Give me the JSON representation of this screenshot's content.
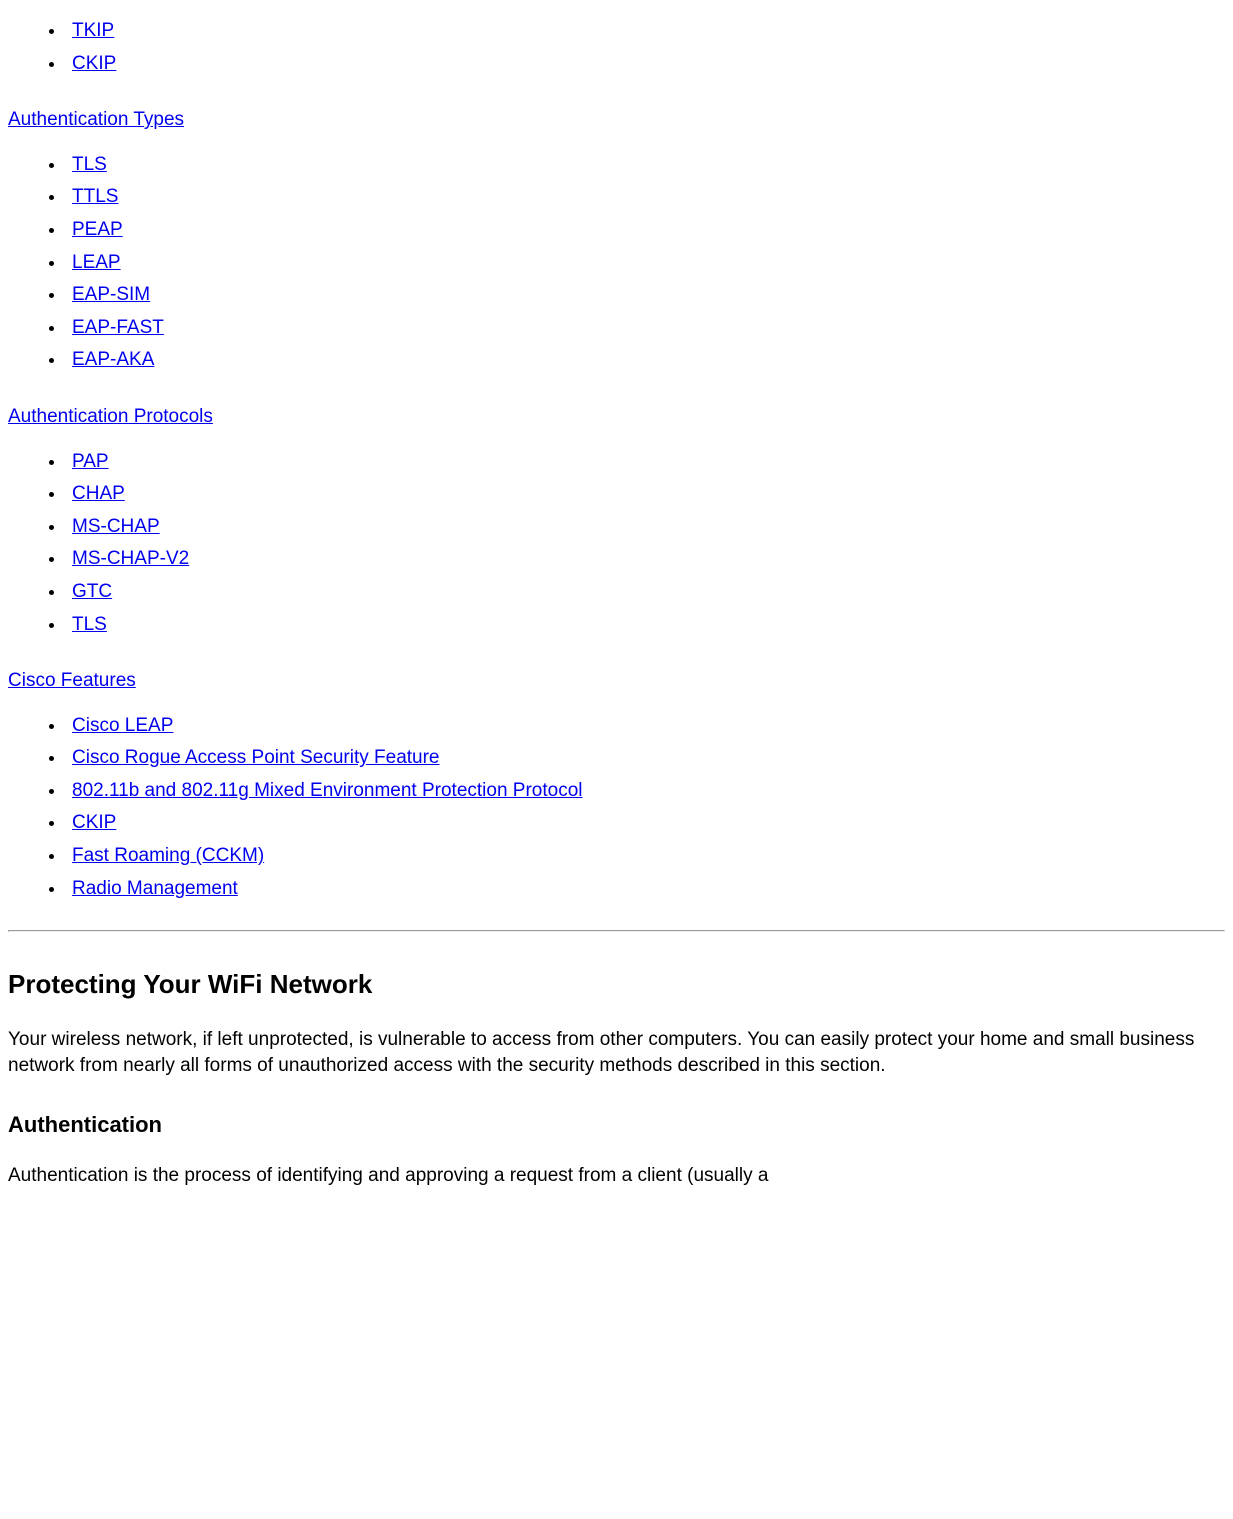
{
  "top_items": [
    "TKIP",
    "CKIP"
  ],
  "sections": [
    {
      "title": "Authentication Types",
      "items": [
        "TLS",
        "TTLS",
        "PEAP",
        "LEAP",
        "EAP-SIM",
        "EAP-FAST",
        "EAP-AKA"
      ]
    },
    {
      "title": "Authentication Protocols",
      "items": [
        "PAP",
        "CHAP",
        "MS-CHAP",
        "MS-CHAP-V2",
        "GTC",
        "TLS"
      ]
    },
    {
      "title": "Cisco Features",
      "items": [
        "Cisco LEAP",
        "Cisco Rogue Access Point Security Feature",
        "802.11b and 802.11g Mixed Environment Protection Protocol",
        "CKIP",
        "Fast Roaming (CCKM)",
        "Radio Management"
      ]
    }
  ],
  "h2": "Protecting Your WiFi Network",
  "para1": "Your wireless network, if left unprotected, is vulnerable to access from other computers. You can easily protect your home and small business network from nearly all forms of unauthorized access with the security methods described in this section.",
  "h3": "Authentication",
  "para2": "Authentication is the process of identifying and approving a request from a client (usually a"
}
